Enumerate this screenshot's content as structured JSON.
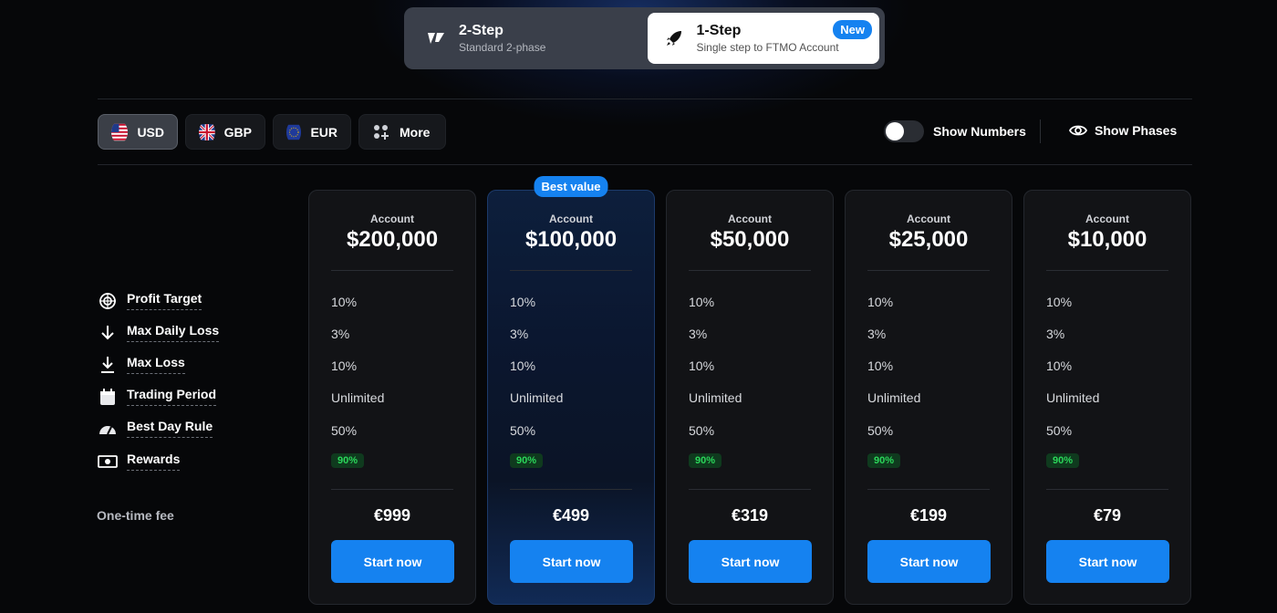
{
  "steps": {
    "two": {
      "title": "2-Step",
      "subtitle": "Standard 2-phase"
    },
    "one": {
      "title": "1-Step",
      "subtitle": "Single step to FTMO Account",
      "badge": "New"
    }
  },
  "currencies": [
    {
      "code": "USD",
      "active": true
    },
    {
      "code": "GBP",
      "active": false
    },
    {
      "code": "EUR",
      "active": false
    },
    {
      "code": "More",
      "active": false
    }
  ],
  "controls": {
    "show_numbers": "Show Numbers",
    "show_phases": "Show Phases"
  },
  "row_labels": {
    "profit_target": "Profit Target",
    "max_daily_loss": "Max Daily Loss",
    "max_loss": "Max Loss",
    "trading_period": "Trading Period",
    "best_day_rule": "Best Day Rule",
    "rewards": "Rewards",
    "fee": "One-time fee"
  },
  "best_badge": "Best value",
  "plans": [
    {
      "account_label": "Account",
      "amount": "$200,000",
      "profit_target": "10%",
      "max_daily_loss": "3%",
      "max_loss": "10%",
      "trading_period": "Unlimited",
      "best_day_rule": "50%",
      "rewards": "90%",
      "price": "€999",
      "cta": "Start now"
    },
    {
      "account_label": "Account",
      "amount": "$100,000",
      "profit_target": "10%",
      "max_daily_loss": "3%",
      "max_loss": "10%",
      "trading_period": "Unlimited",
      "best_day_rule": "50%",
      "rewards": "90%",
      "price": "€499",
      "cta": "Start now"
    },
    {
      "account_label": "Account",
      "amount": "$50,000",
      "profit_target": "10%",
      "max_daily_loss": "3%",
      "max_loss": "10%",
      "trading_period": "Unlimited",
      "best_day_rule": "50%",
      "rewards": "90%",
      "price": "€319",
      "cta": "Start now"
    },
    {
      "account_label": "Account",
      "amount": "$25,000",
      "profit_target": "10%",
      "max_daily_loss": "3%",
      "max_loss": "10%",
      "trading_period": "Unlimited",
      "best_day_rule": "50%",
      "rewards": "90%",
      "price": "€199",
      "cta": "Start now"
    },
    {
      "account_label": "Account",
      "amount": "$10,000",
      "profit_target": "10%",
      "max_daily_loss": "3%",
      "max_loss": "10%",
      "trading_period": "Unlimited",
      "best_day_rule": "50%",
      "rewards": "90%",
      "price": "€79",
      "cta": "Start now"
    }
  ],
  "colors": {
    "accent": "#1582f0",
    "reward_text": "#2bd65a",
    "reward_bg": "#0f3a1e",
    "background": "#060709"
  }
}
